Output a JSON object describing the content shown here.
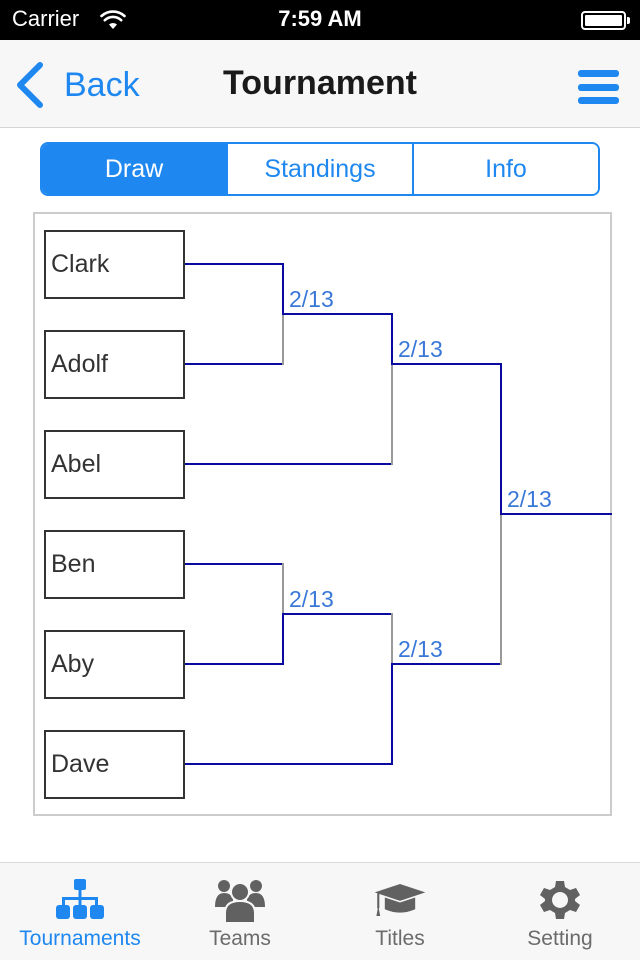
{
  "status_bar": {
    "carrier": "Carrier",
    "time": "7:59 AM",
    "wifi_icon": "wifi-icon",
    "battery_icon": "battery-full-icon"
  },
  "nav": {
    "back_label": "Back",
    "title": "Tournament",
    "back_icon": "chevron-left-icon",
    "menu_icon": "hamburger-menu-icon"
  },
  "segments": [
    {
      "label": "Draw",
      "active": true
    },
    {
      "label": "Standings",
      "active": false
    },
    {
      "label": "Info",
      "active": false
    }
  ],
  "bracket": {
    "players": [
      "Clark",
      "Adolf",
      "Abel",
      "Ben",
      "Aby",
      "Dave"
    ],
    "matches": [
      {
        "round": 1,
        "id": "r1-top",
        "date": "2/13",
        "entrants": [
          "Clark",
          "Adolf"
        ]
      },
      {
        "round": 2,
        "id": "r2-top",
        "date": "2/13",
        "entrants": [
          "winner r1-top",
          "Abel"
        ]
      },
      {
        "round": 1,
        "id": "r1-bottom",
        "date": "2/13",
        "entrants": [
          "Ben",
          "Aby"
        ]
      },
      {
        "round": 2,
        "id": "r2-bottom",
        "date": "2/13",
        "entrants": [
          "winner r1-bottom",
          "Dave"
        ]
      },
      {
        "round": 3,
        "id": "final",
        "date": "2/13",
        "entrants": [
          "winner r2-top",
          "winner r2-bottom"
        ]
      }
    ],
    "colors": {
      "advanced_line": "#0a0aa0",
      "eliminated_line": "#999999",
      "date_text": "#3a78d8"
    }
  },
  "tab_bar": {
    "items": [
      {
        "label": "Tournaments",
        "icon": "hierarchy-icon",
        "active": true
      },
      {
        "label": "Teams",
        "icon": "group-icon",
        "active": false
      },
      {
        "label": "Titles",
        "icon": "graduation-cap-icon",
        "active": false
      },
      {
        "label": "Setting",
        "icon": "gear-icon",
        "active": false
      }
    ]
  },
  "colors": {
    "accent": "#1f88f0",
    "inactive_tab": "#6b6b6b"
  }
}
